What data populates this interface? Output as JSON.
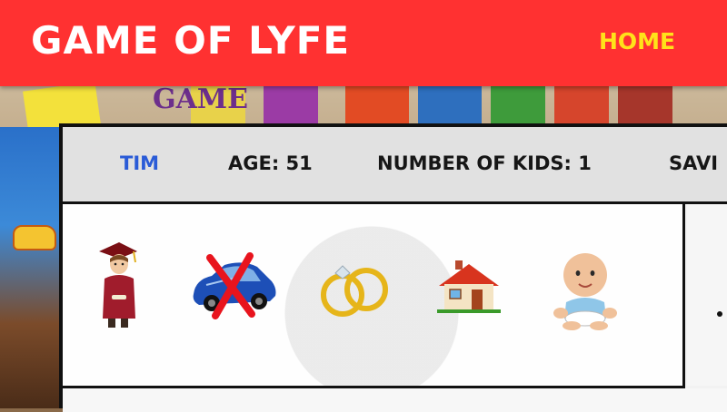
{
  "app": {
    "title": "GAME OF LYFE",
    "nav_home": "HOME"
  },
  "player": {
    "name": "TIM",
    "age_label": "AGE: 51",
    "kids_label": "NUMBER OF KIDS: 1",
    "savings_label": "SAVI"
  },
  "status_icons": [
    {
      "icon": "graduate-icon",
      "meaning": "education"
    },
    {
      "icon": "car-icon-crossed",
      "meaning": "no car"
    },
    {
      "icon": "wedding-rings-icon",
      "meaning": "married"
    },
    {
      "icon": "house-icon",
      "meaning": "house"
    },
    {
      "icon": "baby-icon",
      "meaning": "kids"
    }
  ],
  "colors": {
    "header": "#ff3131",
    "title": "#ffffff",
    "home": "#ffe21a",
    "player_name": "#2a5bd7"
  }
}
